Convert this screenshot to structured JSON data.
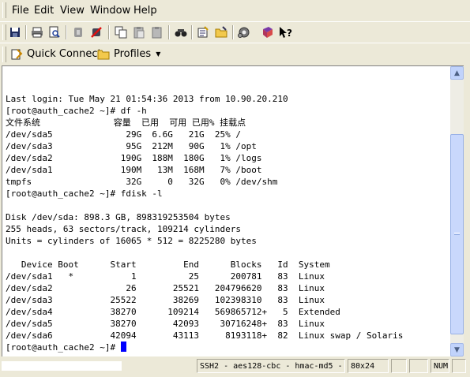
{
  "menu": {
    "file": "File",
    "edit": "Edit",
    "view": "View",
    "window": "Window",
    "help": "Help"
  },
  "toolbar": {
    "buttons": [
      "save-icon",
      "print-icon",
      "print-preview-icon",
      "connect-icon",
      "disconnect-icon",
      "copy-icon",
      "paste-icon",
      "paste-alt-icon",
      "find-icon",
      "new-file-transfer-icon",
      "folder-transfer-icon",
      "settings-icon",
      "profile-book-icon",
      "whats-this-help-icon"
    ]
  },
  "quickbar": {
    "quick_connect": "Quick Connect",
    "profiles": "Profiles"
  },
  "terminal": {
    "lines": [
      "Last login: Tue May 21 01:54:36 2013 from 10.90.20.210",
      "[root@auth_cache2 ~]# df -h",
      "文件系统              容量  已用  可用 已用% 挂载点",
      "/dev/sda5              29G  6.6G   21G  25% /",
      "/dev/sda3              95G  212M   90G   1% /opt",
      "/dev/sda2             190G  188M  180G   1% /logs",
      "/dev/sda1             190M   13M  168M   7% /boot",
      "tmpfs                  32G     0   32G   0% /dev/shm",
      "[root@auth_cache2 ~]# fdisk -l",
      "",
      "Disk /dev/sda: 898.3 GB, 898319253504 bytes",
      "255 heads, 63 sectors/track, 109214 cylinders",
      "Units = cylinders of 16065 * 512 = 8225280 bytes",
      "",
      "   Device Boot      Start         End      Blocks   Id  System",
      "/dev/sda1   *           1          25      200781   83  Linux",
      "/dev/sda2              26       25521   204796620   83  Linux",
      "/dev/sda3           25522       38269   102398310   83  Linux",
      "/dev/sda4           38270      109214   569865712+   5  Extended",
      "/dev/sda5           38270       42093    30716248+  83  Linux",
      "/dev/sda6           42094       43113     8193118+  82  Linux swap / Solaris"
    ],
    "prompt": "[root@auth_cache2 ~]# "
  },
  "status": {
    "connection": "SSH2 - aes128-cbc - hmac-md5 -",
    "size": "80x24",
    "numlock": "NUM"
  },
  "colors": {
    "cursor": "#0000ff",
    "background": "#ffffff",
    "chrome": "#ece9d8"
  }
}
